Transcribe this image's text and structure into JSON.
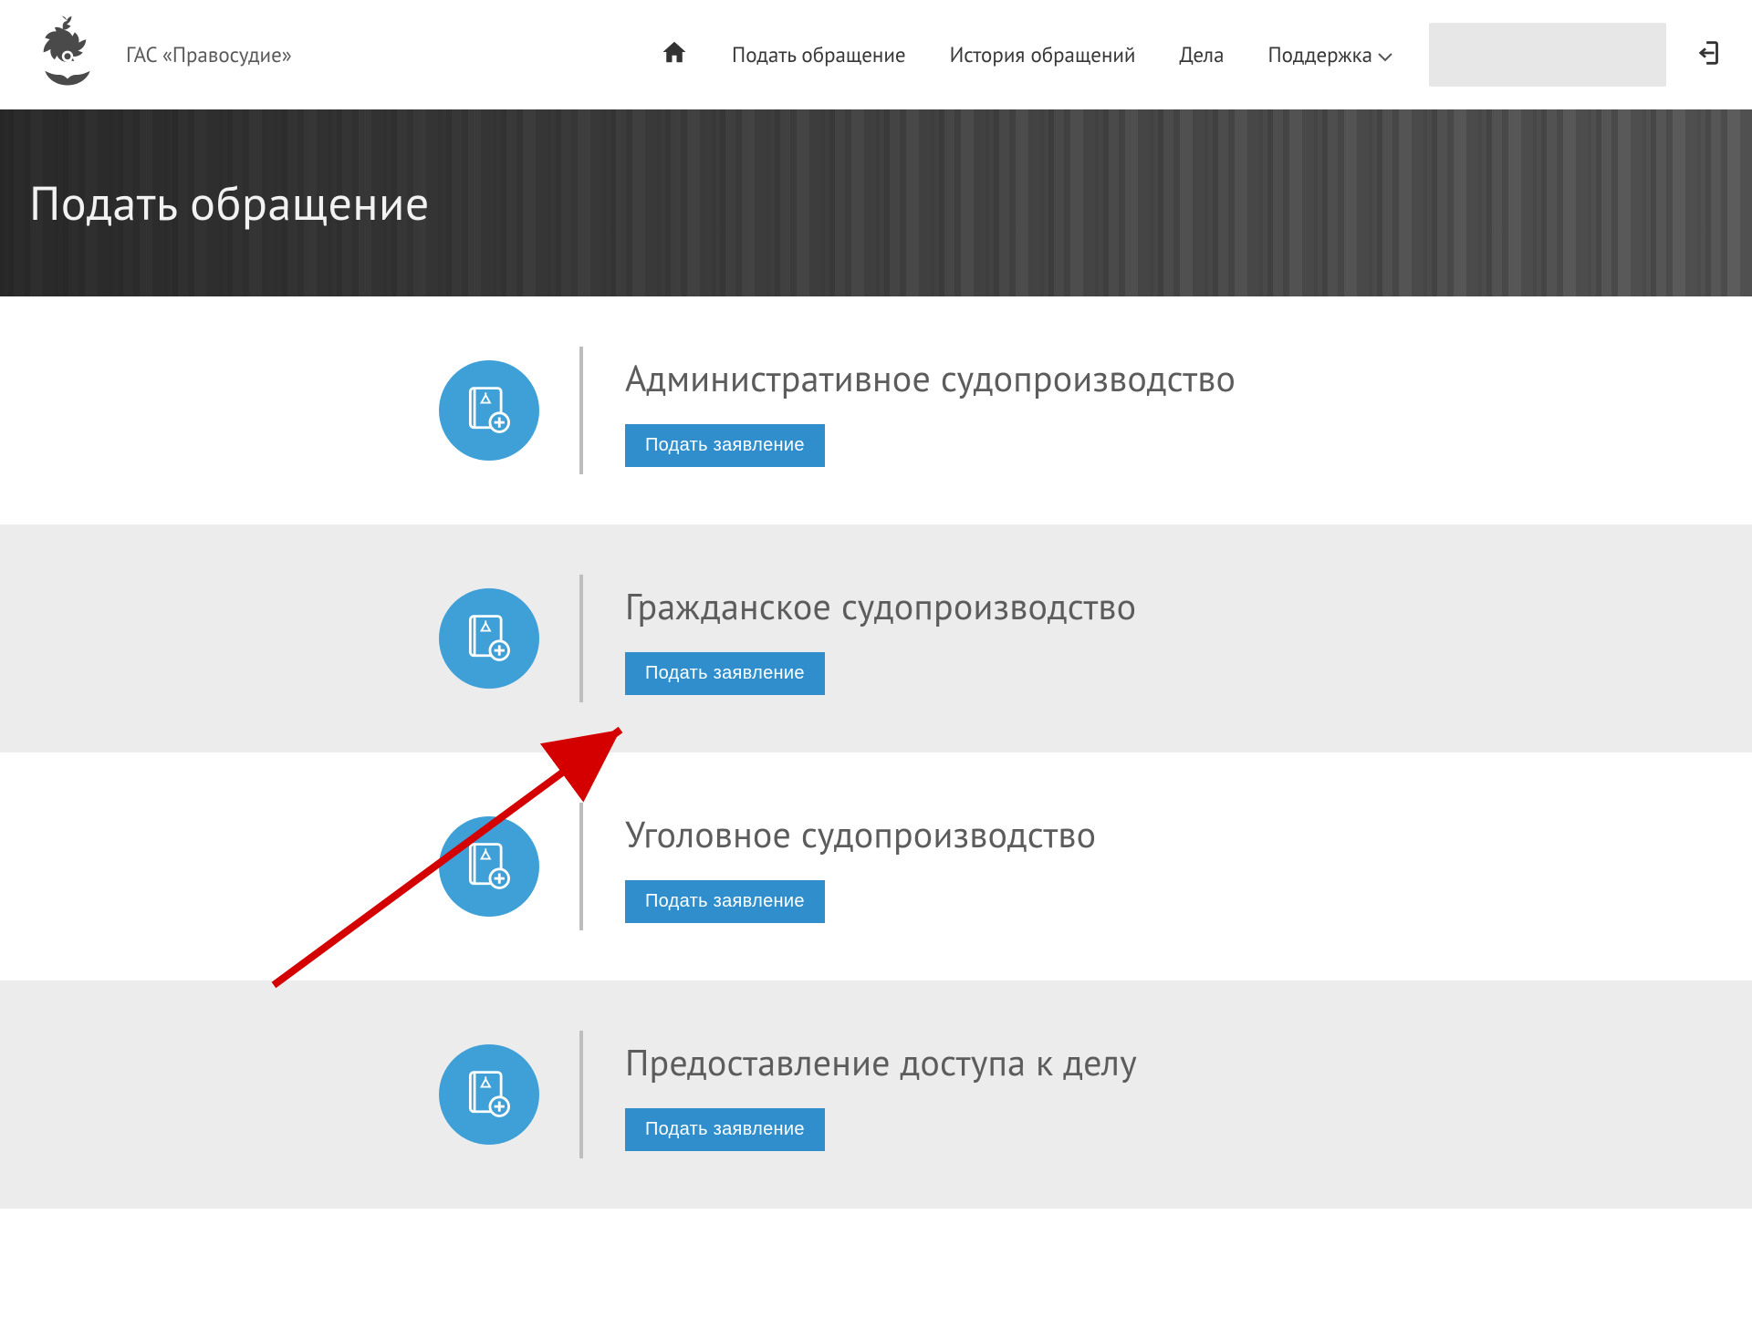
{
  "header": {
    "site_name": "ГАС «Правосудие»",
    "nav": {
      "home": "",
      "submit": "Подать обращение",
      "history": "История обращений",
      "cases": "Дела",
      "support": "Поддержка"
    },
    "user_placeholder": ""
  },
  "banner": {
    "title": "Подать обращение"
  },
  "categories": [
    {
      "title": "Административное судопроизводство",
      "button": "Подать заявление"
    },
    {
      "title": "Гражданское судопроизводство",
      "button": "Подать заявление"
    },
    {
      "title": "Уголовное судопроизводство",
      "button": "Подать заявление"
    },
    {
      "title": "Предоставление доступа к делу",
      "button": "Подать заявление"
    }
  ]
}
